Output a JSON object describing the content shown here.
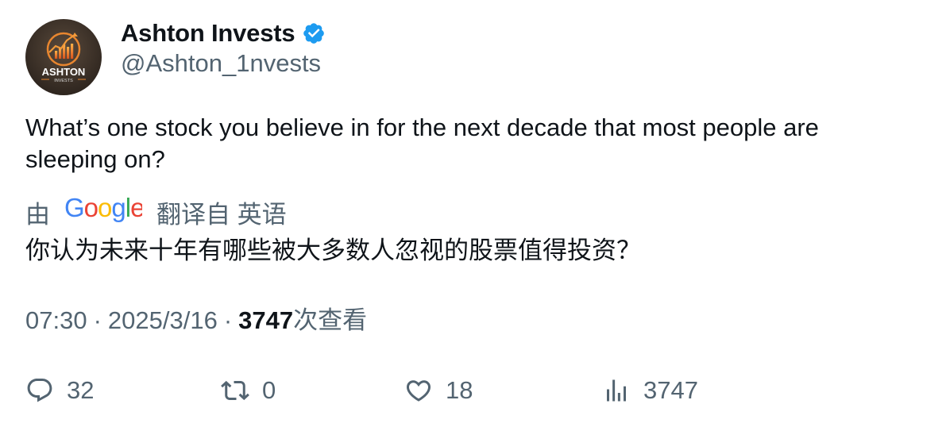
{
  "author": {
    "display_name": "Ashton Invests",
    "handle": "@Ashton_1nvests",
    "verified": true,
    "avatar_text_main": "ASHTON",
    "avatar_text_sub": "INVESTS"
  },
  "tweet": {
    "text": "What’s one stock you believe in for the next decade that most people are sleeping on?"
  },
  "translation": {
    "by_label": "由",
    "provider": "Google",
    "from_label": "翻译自 英语",
    "text": "你认为未来十年有哪些被大多数人忽视的股票值得投资？"
  },
  "meta": {
    "time": "07:30",
    "separator": "·",
    "date": "2025/3/16",
    "views_count": "3747",
    "views_label": "次查看"
  },
  "actions": {
    "reply_count": "32",
    "retweet_count": "0",
    "like_count": "18",
    "views_count": "3747"
  },
  "icons": {
    "reply": "comment-bubble-icon",
    "retweet": "retweet-arrows-icon",
    "like": "heart-icon",
    "views": "bar-chart-icon",
    "verified": "verified-badge-icon"
  },
  "colors": {
    "verified_blue": "#1d9bf0",
    "text_primary": "#0f1419",
    "text_secondary": "#536471"
  }
}
